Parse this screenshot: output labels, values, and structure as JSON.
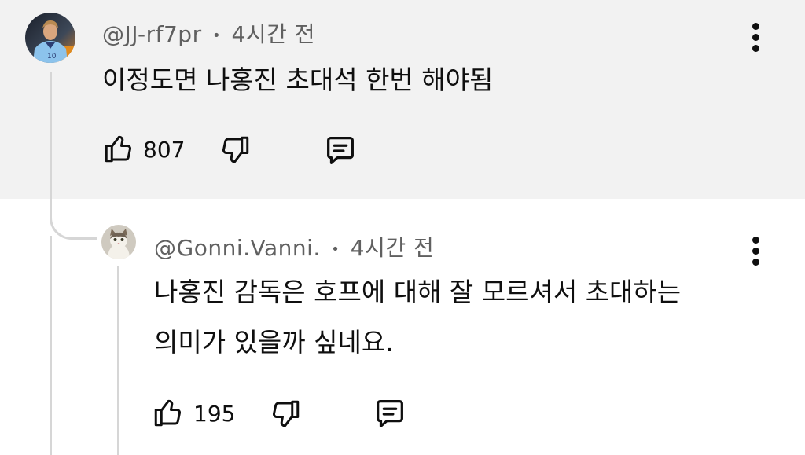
{
  "comment": {
    "author": "@JJ-rf7pr",
    "time": "4시간 전",
    "text": "이정도면 나홍진 초대석 한번 해야됨",
    "likes": "807",
    "avatar": "soccer-player-avatar"
  },
  "reply": {
    "author": "@Gonni.Vanni.",
    "time": "4시간 전",
    "text_line1": "나홍진 감독은 호프에 대해 잘 모르셔서 초대하는",
    "text_line2": "의미가 있을까 싶네요.",
    "likes": "195",
    "avatar": "cat-avatar"
  },
  "separator": "•",
  "colors": {
    "highlight_bg": "#f2f2f2",
    "meta_text": "#606060",
    "thread_line": "#d6d6d6"
  }
}
